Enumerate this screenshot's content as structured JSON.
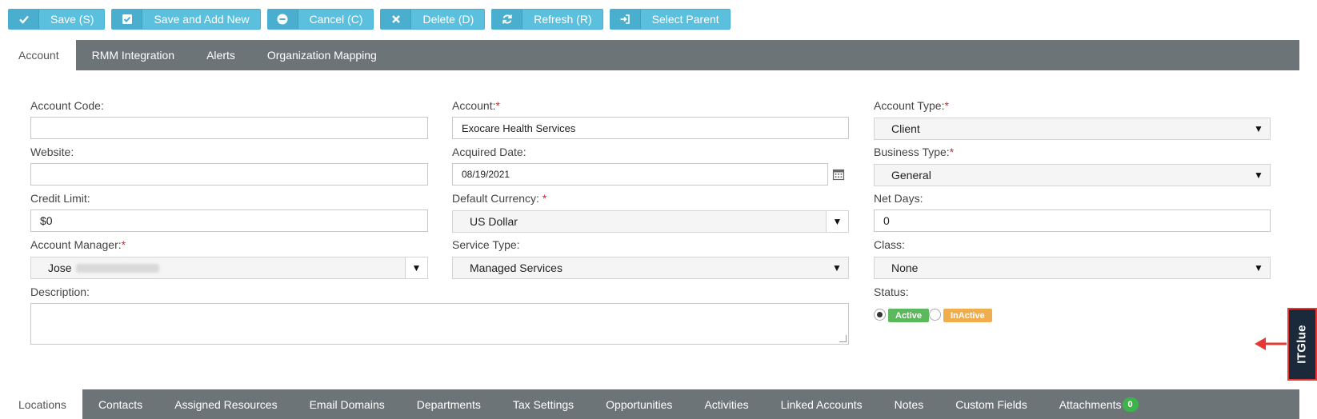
{
  "toolbar": {
    "buttons": [
      {
        "label": "Save (S)",
        "icon": "check-icon"
      },
      {
        "label": "Save and Add New",
        "icon": "check-square-icon"
      },
      {
        "label": "Cancel (C)",
        "icon": "minus-circle-icon"
      },
      {
        "label": "Delete (D)",
        "icon": "x-icon"
      },
      {
        "label": "Refresh (R)",
        "icon": "refresh-icon"
      },
      {
        "label": "Select Parent",
        "icon": "sign-in-icon"
      }
    ]
  },
  "top_tabs": [
    "Account",
    "RMM Integration",
    "Alerts",
    "Organization Mapping"
  ],
  "form": {
    "account_code": {
      "label": "Account Code:",
      "value": ""
    },
    "account": {
      "label": "Account:",
      "required": "*",
      "value": "Exocare Health Services"
    },
    "account_type": {
      "label": "Account Type:",
      "required": "*",
      "value": "Client"
    },
    "website": {
      "label": "Website:",
      "value": ""
    },
    "acquired_date": {
      "label": "Acquired Date:",
      "value": "08/19/2021"
    },
    "business_type": {
      "label": "Business Type:",
      "required": "*",
      "value": "General"
    },
    "credit_limit": {
      "label": "Credit Limit:",
      "value": "$0"
    },
    "default_currency": {
      "label": "Default Currency: ",
      "required": "*",
      "value": "US Dollar"
    },
    "net_days": {
      "label": "Net Days:",
      "value": "0"
    },
    "account_manager": {
      "label": "Account Manager:",
      "required": "*",
      "value": "Jose"
    },
    "service_type": {
      "label": "Service Type:",
      "value": "Managed Services"
    },
    "class": {
      "label": "Class:",
      "value": "None"
    },
    "description": {
      "label": "Description:",
      "value": ""
    },
    "status": {
      "label": "Status:",
      "options": [
        "Active",
        "InActive"
      ],
      "selected": "Active"
    }
  },
  "colors": {
    "toolbar_button": "#5bc0de",
    "tab_bar": "#6d7478",
    "active_badge": "#5cb85c",
    "inactive_badge": "#f0ad4e",
    "count_badge": "#3bb54a",
    "itglue_bg": "#1b2a3a",
    "highlight": "#e53935"
  },
  "side_tab": {
    "label": "ITGlue",
    "icon": "itglue-logo-icon"
  },
  "bottom_tabs": [
    {
      "label": "Locations"
    },
    {
      "label": "Contacts"
    },
    {
      "label": "Assigned Resources"
    },
    {
      "label": "Email Domains"
    },
    {
      "label": "Departments"
    },
    {
      "label": "Tax Settings"
    },
    {
      "label": "Opportunities"
    },
    {
      "label": "Activities"
    },
    {
      "label": "Linked Accounts"
    },
    {
      "label": "Notes"
    },
    {
      "label": "Custom Fields"
    },
    {
      "label": "Attachments",
      "count": "0"
    }
  ]
}
